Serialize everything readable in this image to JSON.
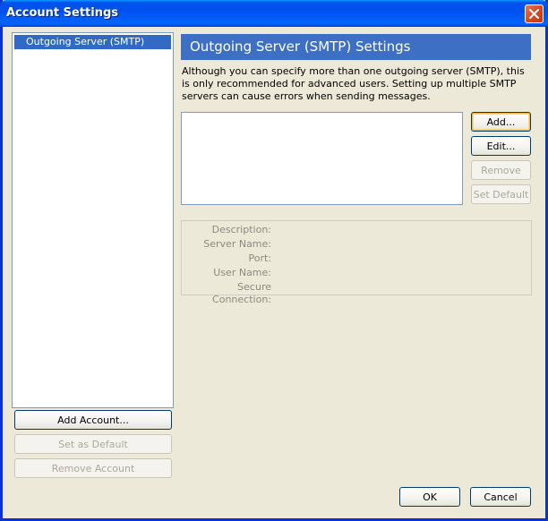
{
  "window": {
    "title": "Account Settings"
  },
  "accounts": {
    "items": [
      {
        "label": "Outgoing Server (SMTP)",
        "selected": true
      }
    ],
    "add_account_label": "Add Account...",
    "set_default_label": "Set as Default",
    "remove_account_label": "Remove Account"
  },
  "smtp": {
    "header": "Outgoing Server (SMTP) Settings",
    "description": "Although you can specify more than one outgoing server (SMTP), this is only recommended for advanced users. Setting up multiple SMTP servers can cause errors when sending messages.",
    "add_label": "Add...",
    "edit_label": "Edit...",
    "remove_label": "Remove",
    "set_default_label": "Set Default",
    "details": {
      "description_label": "Description:",
      "server_name_label": "Server Name:",
      "port_label": "Port:",
      "user_name_label": "User Name:",
      "secure_connection_label": "Secure Connection:"
    }
  },
  "footer": {
    "ok_label": "OK",
    "cancel_label": "Cancel"
  },
  "icons": {
    "close": "close-icon"
  },
  "colors": {
    "titlebar": "#0053ee",
    "selection": "#316ac5",
    "header_bar": "#3d6fc5",
    "dialog_bg": "#ece9d8"
  }
}
